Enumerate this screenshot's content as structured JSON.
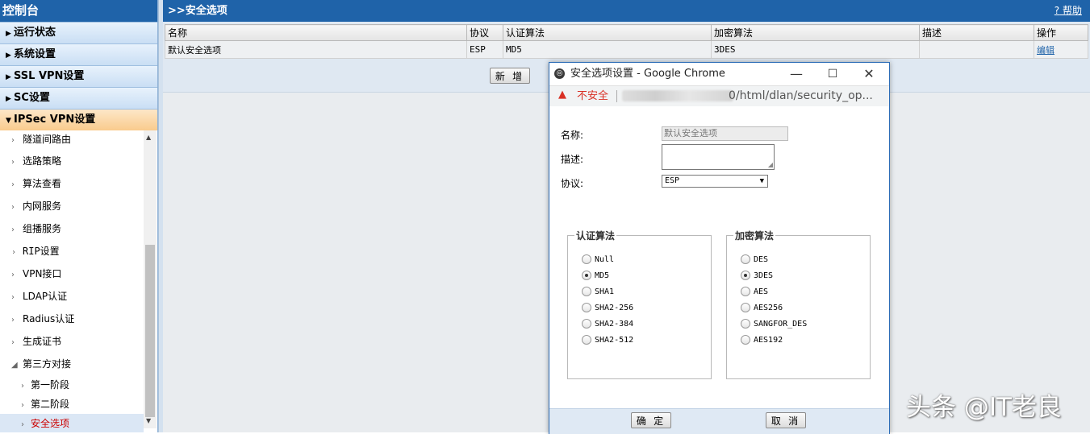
{
  "sidebar": {
    "title": "控制台",
    "sections": [
      {
        "label": "运行状态",
        "icon": "triangle-right-icon"
      },
      {
        "label": "系统设置",
        "icon": "triangle-right-icon"
      },
      {
        "label": "SSL VPN设置",
        "icon": "triangle-right-icon"
      },
      {
        "label": "SC设置",
        "icon": "triangle-right-icon"
      },
      {
        "label": "IPSec VPN设置",
        "icon": "triangle-down-icon"
      }
    ],
    "items": [
      {
        "label": "隧道间路由"
      },
      {
        "label": "选路策略"
      },
      {
        "label": "算法查看"
      },
      {
        "label": "内网服务"
      },
      {
        "label": "组播服务"
      },
      {
        "label": "RIP设置"
      },
      {
        "label": "VPN接口"
      },
      {
        "label": "LDAP认证"
      },
      {
        "label": "Radius认证"
      },
      {
        "label": "生成证书"
      },
      {
        "label": "第三方对接"
      }
    ],
    "subitems": [
      {
        "label": "第一阶段"
      },
      {
        "label": "第二阶段"
      },
      {
        "label": "安全选项"
      }
    ]
  },
  "main": {
    "title": ">>安全选项",
    "help": "帮助",
    "columns": [
      "名称",
      "协议",
      "认证算法",
      "加密算法",
      "描述",
      "操作"
    ],
    "rows": [
      {
        "name": "默认安全选项",
        "protocol": "ESP",
        "auth": "MD5",
        "enc": "3DES",
        "desc": "",
        "op": "编辑"
      }
    ],
    "new_button": "新 增"
  },
  "popup": {
    "title": "安全选项设置 - Google Chrome",
    "minimize": "—",
    "maximize": "☐",
    "close": "✕",
    "warning": "不安全",
    "url_visible": "0/html/dlan/security_op...",
    "name_label": "名称:",
    "name_value": "默认安全选项",
    "desc_label": "描述:",
    "protocol_label": "协议:",
    "protocol_value": "ESP",
    "auth_group": {
      "legend": "认证算法",
      "options": [
        "Null",
        "MD5",
        "SHA1",
        "SHA2-256",
        "SHA2-384",
        "SHA2-512"
      ],
      "selected": "MD5"
    },
    "enc_group": {
      "legend": "加密算法",
      "options": [
        "DES",
        "3DES",
        "AES",
        "AES256",
        "SANGFOR_DES",
        "AES192"
      ],
      "selected": "3DES"
    },
    "ok_button": "确 定",
    "cancel_button": "取 消"
  },
  "watermark": "头条 @IT老良",
  "colors": {
    "header_blue": "#1f63a9",
    "warning_red": "#d93025",
    "selected_text": "#cc0000",
    "link_blue": "#1f63a9"
  }
}
